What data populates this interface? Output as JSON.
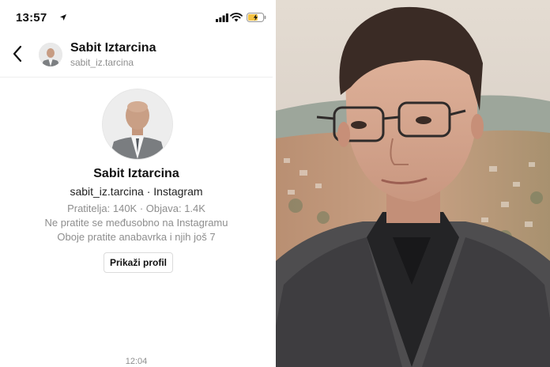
{
  "status_bar": {
    "time": "13:57"
  },
  "header": {
    "name": "Sabit Iztarcina",
    "username": "sabit_iz.tarcina"
  },
  "profile": {
    "name": "Sabit Iztarcina",
    "subtitle": "sabit_iz.tarcina · Instagram",
    "stats": "Pratitelja: 140K · Objava: 1.4K",
    "mutual": "Ne pratite se međusobno na Instagramu",
    "followers": "Oboje pratite anabavrka i njih još 7",
    "button_label": "Prikaži profil"
  },
  "message": {
    "timestamp": "12:04"
  },
  "icons": [
    "location-arrow-icon",
    "signal-icon",
    "wifi-icon",
    "battery-charging-icon",
    "back-chevron-icon"
  ],
  "colors": {
    "secondary_text": "#8e8e8e",
    "battery_fill": "#f5c343"
  }
}
